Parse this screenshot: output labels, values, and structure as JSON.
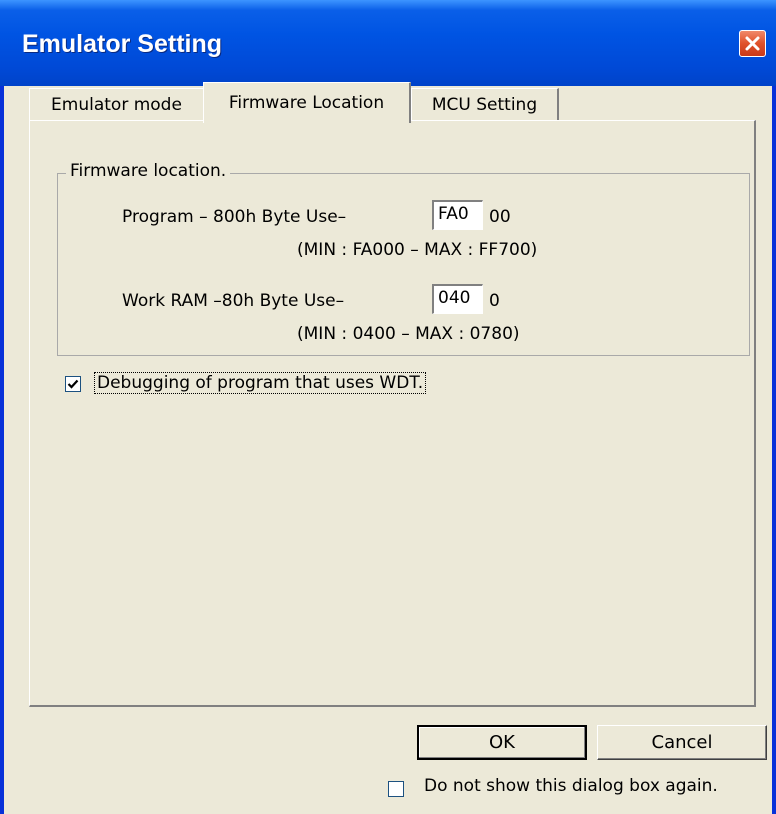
{
  "window": {
    "title": "Emulator Setting"
  },
  "tabs": [
    {
      "label": "Emulator mode"
    },
    {
      "label": "Firmware Location"
    },
    {
      "label": "MCU Setting"
    }
  ],
  "firmware_group": {
    "legend": "Firmware location.",
    "program": {
      "label": "Program – 800h  Byte Use–",
      "value": "FA0",
      "suffix": "00",
      "range": "(MIN : FA000  –  MAX : FF700)"
    },
    "work_ram": {
      "label": "Work RAM –80h Byte Use–",
      "value": "040",
      "suffix": "0",
      "range": "(MIN : 0400  –  MAX : 0780)"
    }
  },
  "wdt_checkbox": {
    "label": "Debugging of program that uses WDT.",
    "checked": true
  },
  "buttons": {
    "ok": "OK",
    "cancel": "Cancel"
  },
  "dont_show_checkbox": {
    "label": "Do not show this dialog box again.",
    "checked": false
  },
  "colors": {
    "title_bar": "#0054E3",
    "close_button": "#E0512A",
    "face": "#ECE9D8"
  }
}
